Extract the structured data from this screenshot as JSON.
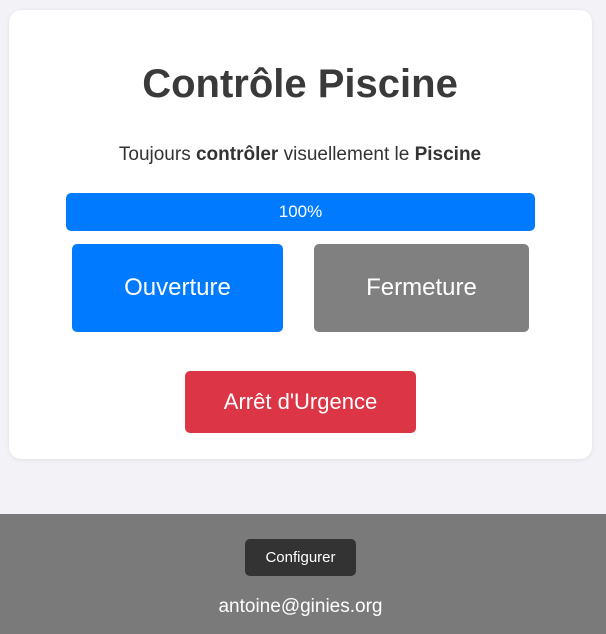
{
  "colors": {
    "page_background": "#f2f2f7",
    "card_background": "#ffffff",
    "primary": "#007bff",
    "secondary": "#808080",
    "danger": "#dc3545",
    "footer_background": "#7a7a7a",
    "footer_button": "#333333"
  },
  "main": {
    "title": "Contrôle Piscine",
    "subtitle": {
      "part1": "Toujours ",
      "bold1": "contrôler",
      "part2": " visuellement le ",
      "bold2": "Piscine"
    },
    "progress": {
      "value": 1.0,
      "label": "100%"
    },
    "buttons": {
      "open_label": "Ouverture",
      "close_label": "Fermeture",
      "emergency_label": "Arrêt d'Urgence"
    }
  },
  "footer": {
    "config_label": "Configurer",
    "email": "antoine@ginies.org"
  }
}
